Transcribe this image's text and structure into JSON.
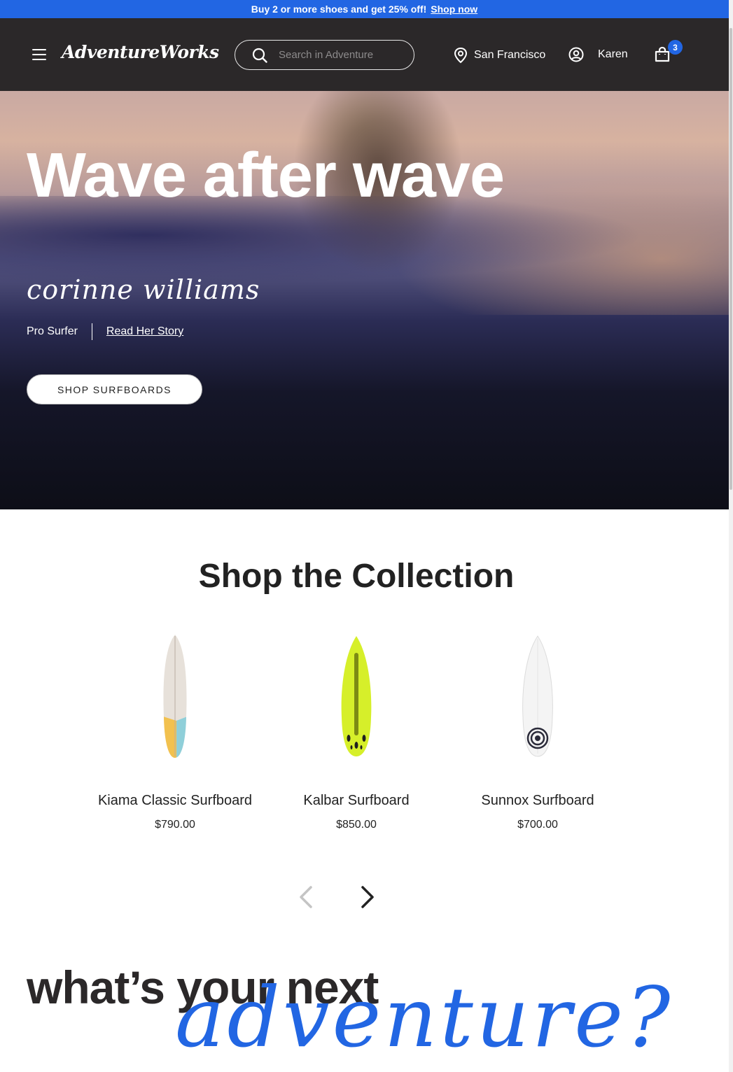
{
  "promo": {
    "text": "Buy 2 or more shoes and get 25% off!",
    "link": "Shop now"
  },
  "header": {
    "logo": "AdventureWorks",
    "search_placeholder": "Search in Adventure",
    "location": "San Francisco",
    "user": "Karen",
    "cart_count": "3"
  },
  "hero": {
    "title": "Wave after wave",
    "signature": "corinne williams",
    "role": "Pro Surfer",
    "story_link": "Read Her Story",
    "cta": "SHOP SURFBOARDS"
  },
  "collection": {
    "title": "Shop the Collection",
    "products": [
      {
        "name": "Kiama Classic Surfboard",
        "price": "$790.00"
      },
      {
        "name": "Kalbar Surfboard",
        "price": "$850.00"
      },
      {
        "name": "Sunnox Surfboard",
        "price": "$700.00"
      }
    ]
  },
  "banner": {
    "line1": "what’s your next",
    "line2": "adventure?"
  },
  "colors": {
    "accent": "#2266e3",
    "header_bg": "#2b2829"
  },
  "icons": [
    "menu-icon",
    "search-icon",
    "location-pin-icon",
    "user-icon",
    "shopping-bag-icon",
    "chevron-left-icon",
    "chevron-right-icon"
  ]
}
